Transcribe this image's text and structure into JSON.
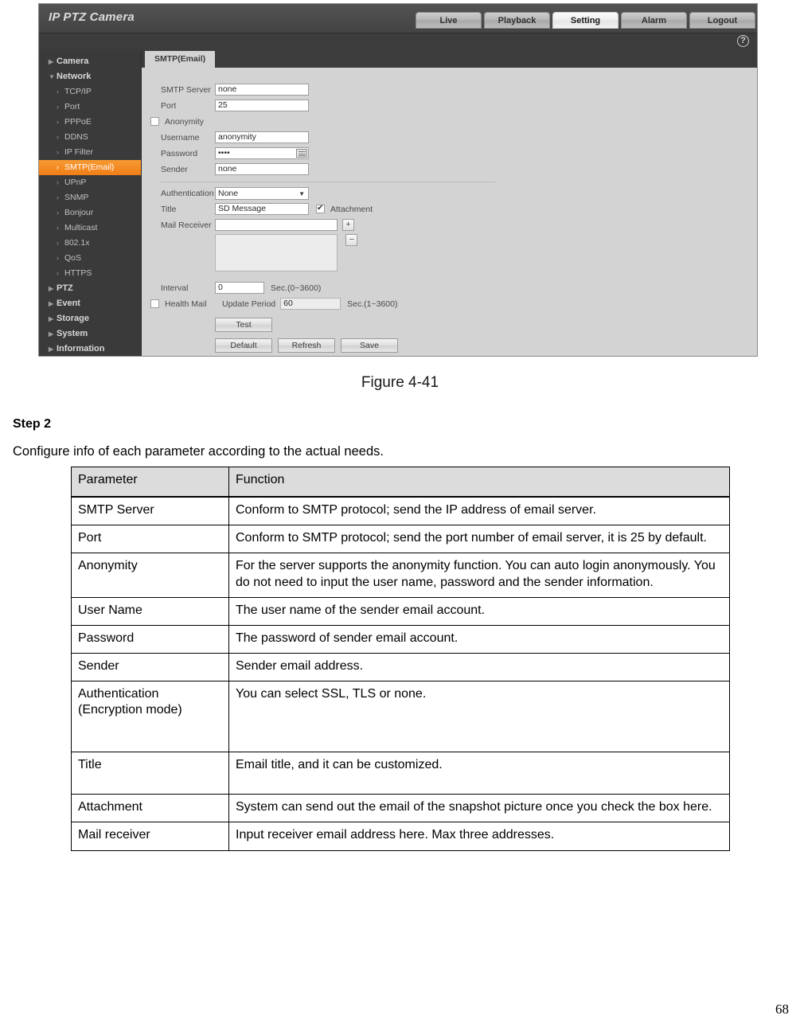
{
  "screenshot": {
    "app_title": "IP PTZ Camera",
    "nav_tabs": [
      {
        "label": "Live",
        "active": false
      },
      {
        "label": "Playback",
        "active": false
      },
      {
        "label": "Setting",
        "active": true
      },
      {
        "label": "Alarm",
        "active": false
      },
      {
        "label": "Logout",
        "active": false
      }
    ],
    "help_icon": "?",
    "sidebar": [
      {
        "label": "Camera",
        "type": "group",
        "state": "collapsed"
      },
      {
        "label": "Network",
        "type": "group",
        "state": "expanded"
      },
      {
        "label": "TCP/IP",
        "type": "child",
        "selected": false
      },
      {
        "label": "Port",
        "type": "child",
        "selected": false
      },
      {
        "label": "PPPoE",
        "type": "child",
        "selected": false
      },
      {
        "label": "DDNS",
        "type": "child",
        "selected": false
      },
      {
        "label": "IP Filter",
        "type": "child",
        "selected": false
      },
      {
        "label": "SMTP(Email)",
        "type": "child",
        "selected": true
      },
      {
        "label": "UPnP",
        "type": "child",
        "selected": false
      },
      {
        "label": "SNMP",
        "type": "child",
        "selected": false
      },
      {
        "label": "Bonjour",
        "type": "child",
        "selected": false
      },
      {
        "label": "Multicast",
        "type": "child",
        "selected": false
      },
      {
        "label": "802.1x",
        "type": "child",
        "selected": false
      },
      {
        "label": "QoS",
        "type": "child",
        "selected": false
      },
      {
        "label": "HTTPS",
        "type": "child",
        "selected": false
      },
      {
        "label": "PTZ",
        "type": "group",
        "state": "collapsed"
      },
      {
        "label": "Event",
        "type": "group",
        "state": "collapsed"
      },
      {
        "label": "Storage",
        "type": "group",
        "state": "collapsed"
      },
      {
        "label": "System",
        "type": "group",
        "state": "collapsed"
      },
      {
        "label": "Information",
        "type": "group",
        "state": "collapsed"
      }
    ],
    "panel_tab": "SMTP(Email)",
    "form": {
      "smtp_server_label": "SMTP Server",
      "smtp_server_value": "none",
      "port_label": "Port",
      "port_value": "25",
      "anonymity_label": "Anonymity",
      "anonymity_checked": false,
      "username_label": "Username",
      "username_value": "anonymity",
      "password_label": "Password",
      "password_value": "••••",
      "sender_label": "Sender",
      "sender_value": "none",
      "authentication_label": "Authentication",
      "authentication_value": "None",
      "authentication_options": [
        "None",
        "SSL",
        "TLS"
      ],
      "title_label": "Title",
      "title_value": "SD Message",
      "attachment_label": "Attachment",
      "attachment_checked": true,
      "mail_receiver_label": "Mail Receiver",
      "mail_receiver_value": "",
      "mail_receiver_list": "",
      "add_button": "+",
      "remove_button": "−",
      "interval_label": "Interval",
      "interval_value": "0",
      "interval_unit": "Sec.(0~3600)",
      "health_mail_label": "Health Mail",
      "health_mail_checked": false,
      "update_period_label": "Update Period",
      "update_period_value": "60",
      "update_period_unit": "Sec.(1~3600)",
      "test_button": "Test",
      "default_button": "Default",
      "refresh_button": "Refresh",
      "save_button": "Save"
    },
    "accent_color": "#f28a1e",
    "sidebar_color": "#3a3a3a",
    "panel_color": "#d3d3d3"
  },
  "document": {
    "figure_caption": "Figure 4-41",
    "step_heading": "Step 2",
    "step_text": "Configure info of each parameter according to the actual needs.",
    "page_number": "68",
    "table": {
      "headers": [
        "Parameter",
        "Function"
      ],
      "rows": [
        {
          "parameter": "SMTP Server",
          "function": "Conform to SMTP protocol; send the IP address of email server."
        },
        {
          "parameter": "Port",
          "function": "Conform to SMTP protocol; send the port number of email server, it is 25 by default."
        },
        {
          "parameter": "Anonymity",
          "function": "For the server supports the anonymity function. You can auto login anonymously. You do not need to input the user name, password and the sender information."
        },
        {
          "parameter": "User Name",
          "function": "The user name of the sender email account."
        },
        {
          "parameter": "Password",
          "function": "The password of sender email account."
        },
        {
          "parameter": "Sender",
          "function": "Sender email address."
        },
        {
          "parameter": "Authentication (Encryption mode)",
          "function": "You can select SSL, TLS or none."
        },
        {
          "parameter": "Title",
          "function": "Email title, and it can be customized."
        },
        {
          "parameter": "Attachment",
          "function": "System can send out the email of the snapshot picture once you check the box here."
        },
        {
          "parameter": "Mail receiver",
          "function": "Input receiver email address here. Max three addresses."
        }
      ]
    }
  }
}
